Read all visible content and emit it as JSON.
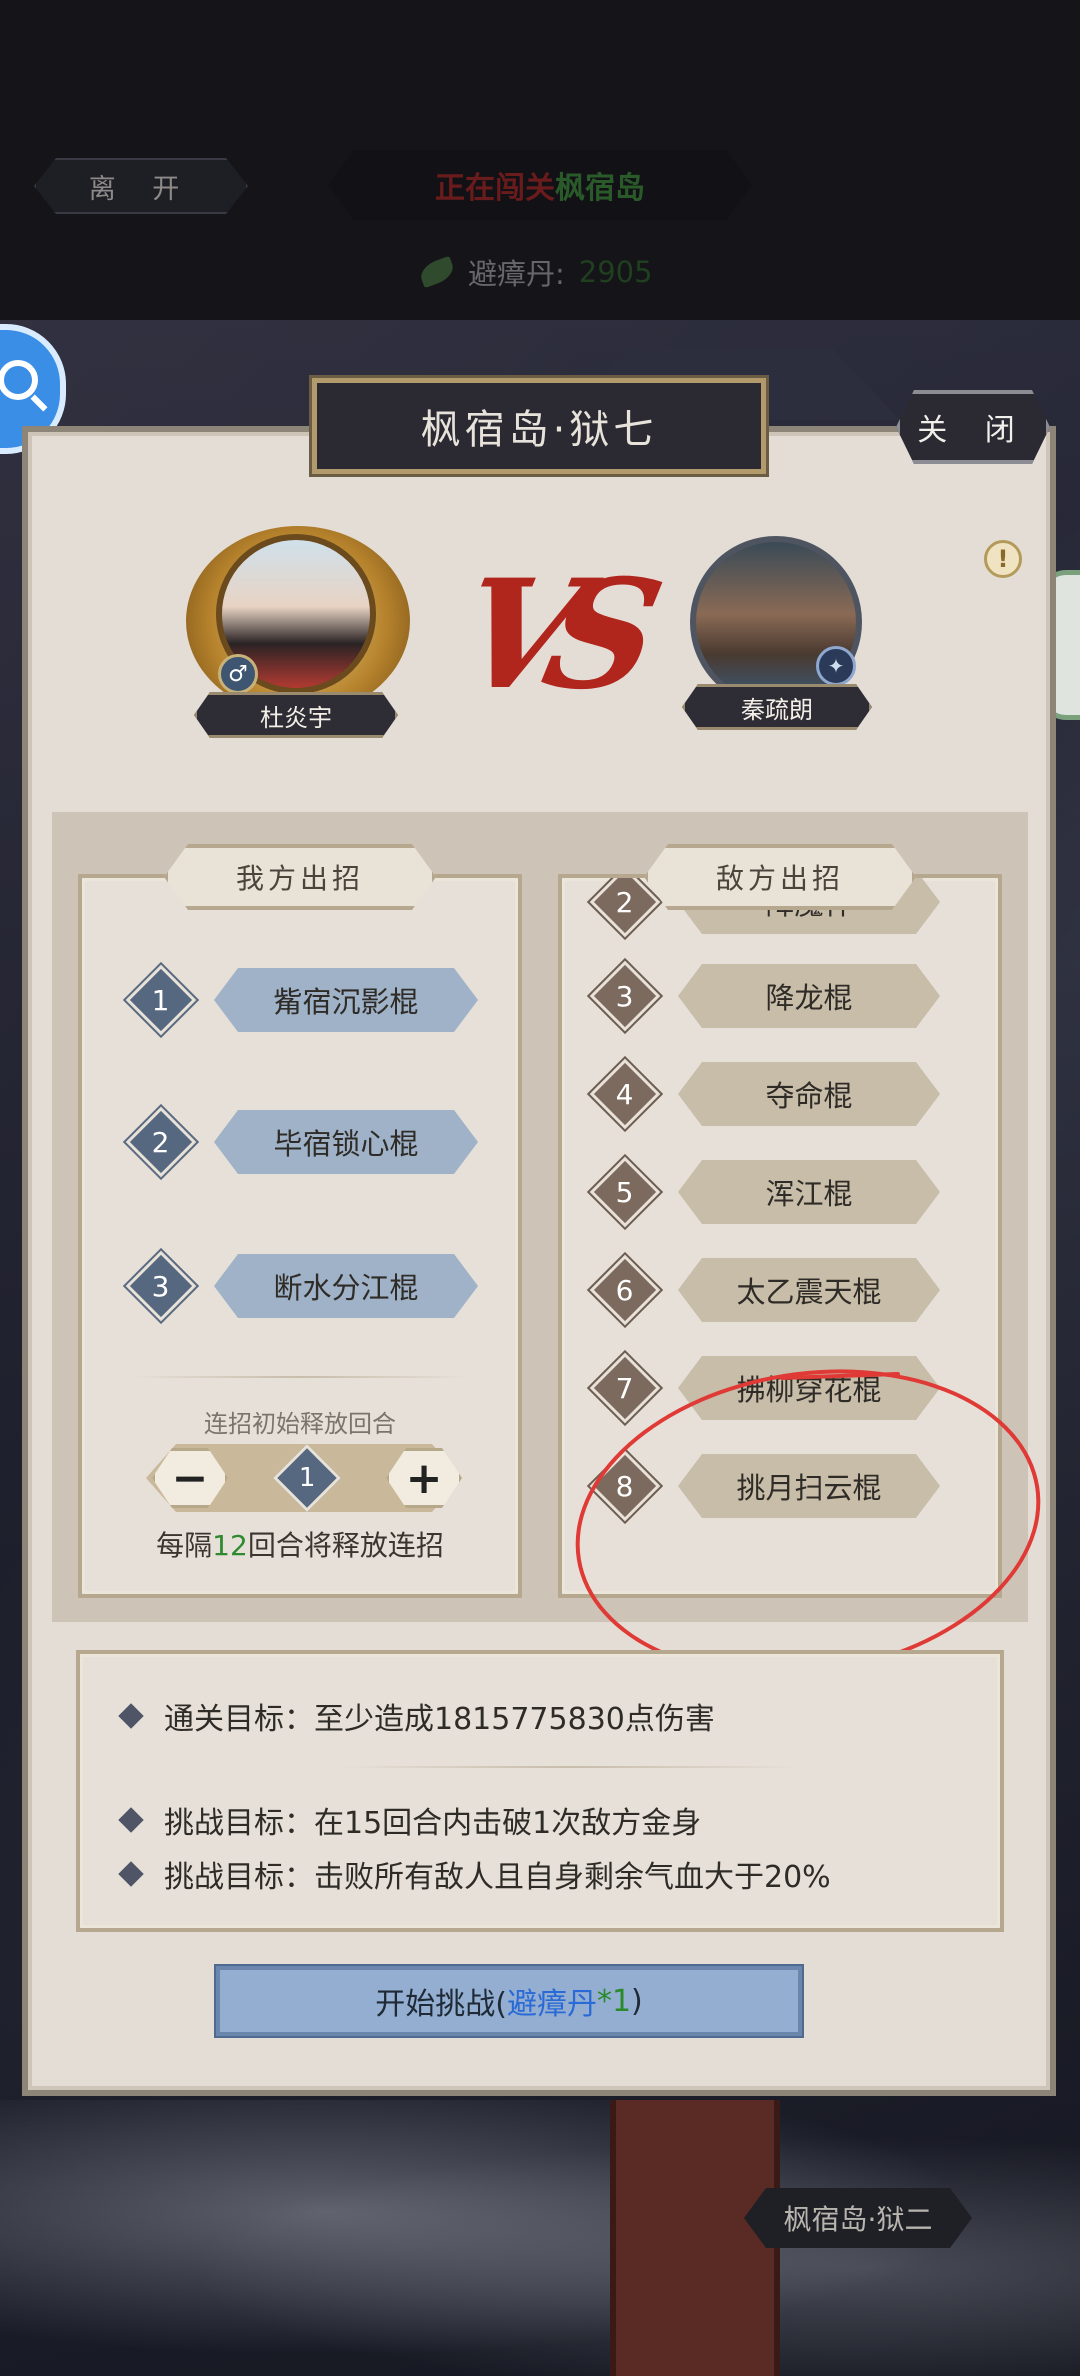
{
  "top": {
    "leave_label": "离 开",
    "stage_prefix": "正在闯关",
    "stage_name": "枫宿岛",
    "currency_name": "避瘴丹:",
    "currency_amount": "2905"
  },
  "modal": {
    "title": "枫宿岛·狱七",
    "close_label": "关 闭",
    "info_icon": "!",
    "vs_text": "VS",
    "player_name": "杜炎宇",
    "enemy_name": "秦疏朗",
    "gender_symbol": "♂"
  },
  "my_moves": {
    "header": "我方出招",
    "items": [
      {
        "num": "1",
        "label": "觜宿沉影棍"
      },
      {
        "num": "2",
        "label": "毕宿锁心棍"
      },
      {
        "num": "3",
        "label": "断水分江棍"
      }
    ],
    "combo_label": "连招初始释放回合",
    "combo_value": "1",
    "minus": "−",
    "plus": "+",
    "interval_prefix": "每隔",
    "interval_num": "12",
    "interval_suffix": "回合将释放连招"
  },
  "enemy_moves": {
    "header": "敌方出招",
    "items": [
      {
        "num": "2",
        "label": "降魔杵"
      },
      {
        "num": "3",
        "label": "降龙棍"
      },
      {
        "num": "4",
        "label": "夺命棍"
      },
      {
        "num": "5",
        "label": "浑江棍"
      },
      {
        "num": "6",
        "label": "太乙震天棍"
      },
      {
        "num": "7",
        "label": "拂柳穿花棍"
      },
      {
        "num": "8",
        "label": "挑月扫云棍"
      }
    ]
  },
  "goals": [
    "通关目标：至少造成1815775830点伤害",
    "挑战目标：在15回合内击破1次敌方金身",
    "挑战目标：击败所有敌人且自身剩余气血大于20%"
  ],
  "start": {
    "prefix": "开始挑战(",
    "item": "避瘴丹",
    "qty": "*1",
    "suffix": ")"
  },
  "next_stage": "枫宿岛·狱二",
  "colors": {
    "annotation_red": "#e03a36",
    "accent_blue": "#93aed1",
    "title_dark": "#2b2a33"
  }
}
